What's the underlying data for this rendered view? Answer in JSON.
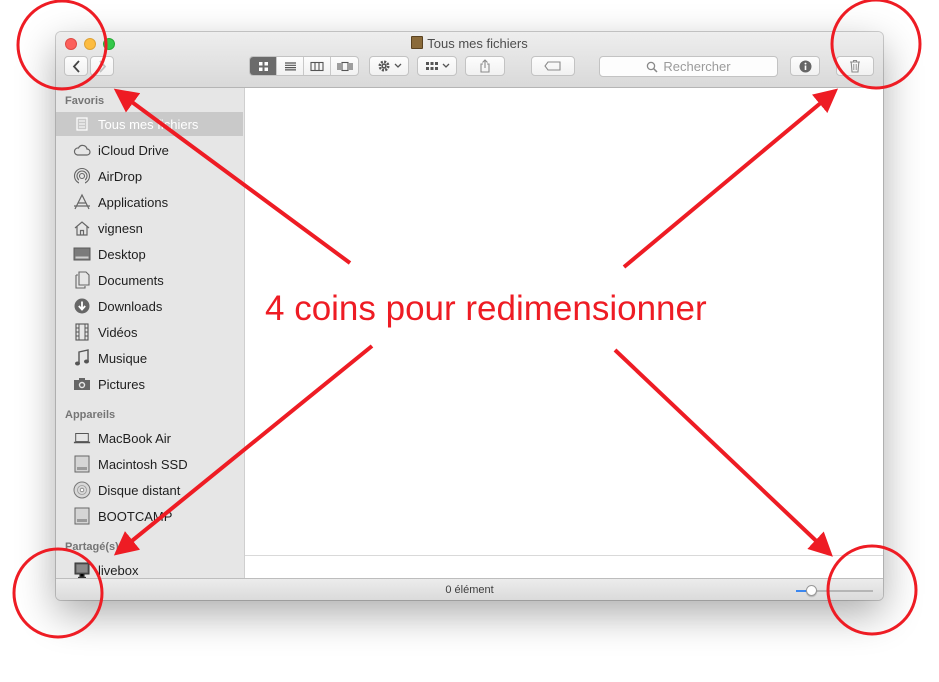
{
  "window": {
    "title": "Tous mes fichiers",
    "search_placeholder": "Rechercher",
    "view_modes": [
      "icon-view",
      "list-view",
      "column-view",
      "cover-flow-view"
    ],
    "active_view": "icon-view"
  },
  "sidebar": {
    "sections": [
      {
        "title": "Favoris",
        "items": [
          {
            "label": "Tous mes fichiers",
            "icon": "all-files-icon",
            "selected": true
          },
          {
            "label": "iCloud Drive",
            "icon": "cloud-icon"
          },
          {
            "label": "AirDrop",
            "icon": "airdrop-icon"
          },
          {
            "label": "Applications",
            "icon": "applications-icon"
          },
          {
            "label": "vignesn",
            "icon": "home-icon"
          },
          {
            "label": "Desktop",
            "icon": "desktop-icon"
          },
          {
            "label": "Documents",
            "icon": "documents-icon"
          },
          {
            "label": "Downloads",
            "icon": "downloads-icon"
          },
          {
            "label": "Vidéos",
            "icon": "film-icon"
          },
          {
            "label": "Musique",
            "icon": "music-icon"
          },
          {
            "label": "Pictures",
            "icon": "camera-icon"
          }
        ]
      },
      {
        "title": "Appareils",
        "items": [
          {
            "label": "MacBook Air",
            "icon": "laptop-icon"
          },
          {
            "label": "Macintosh SSD",
            "icon": "drive-icon"
          },
          {
            "label": "Disque distant",
            "icon": "disc-icon"
          },
          {
            "label": "BOOTCAMP",
            "icon": "drive-icon"
          }
        ]
      },
      {
        "title": "Partagé(s)",
        "items": [
          {
            "label": "livebox",
            "icon": "computer-icon"
          }
        ]
      }
    ]
  },
  "status": {
    "text": "0 élément",
    "icon_size_level": 0.2
  },
  "annotation": {
    "text": "4 coins pour redimensionner",
    "color": "#ee1c24"
  }
}
